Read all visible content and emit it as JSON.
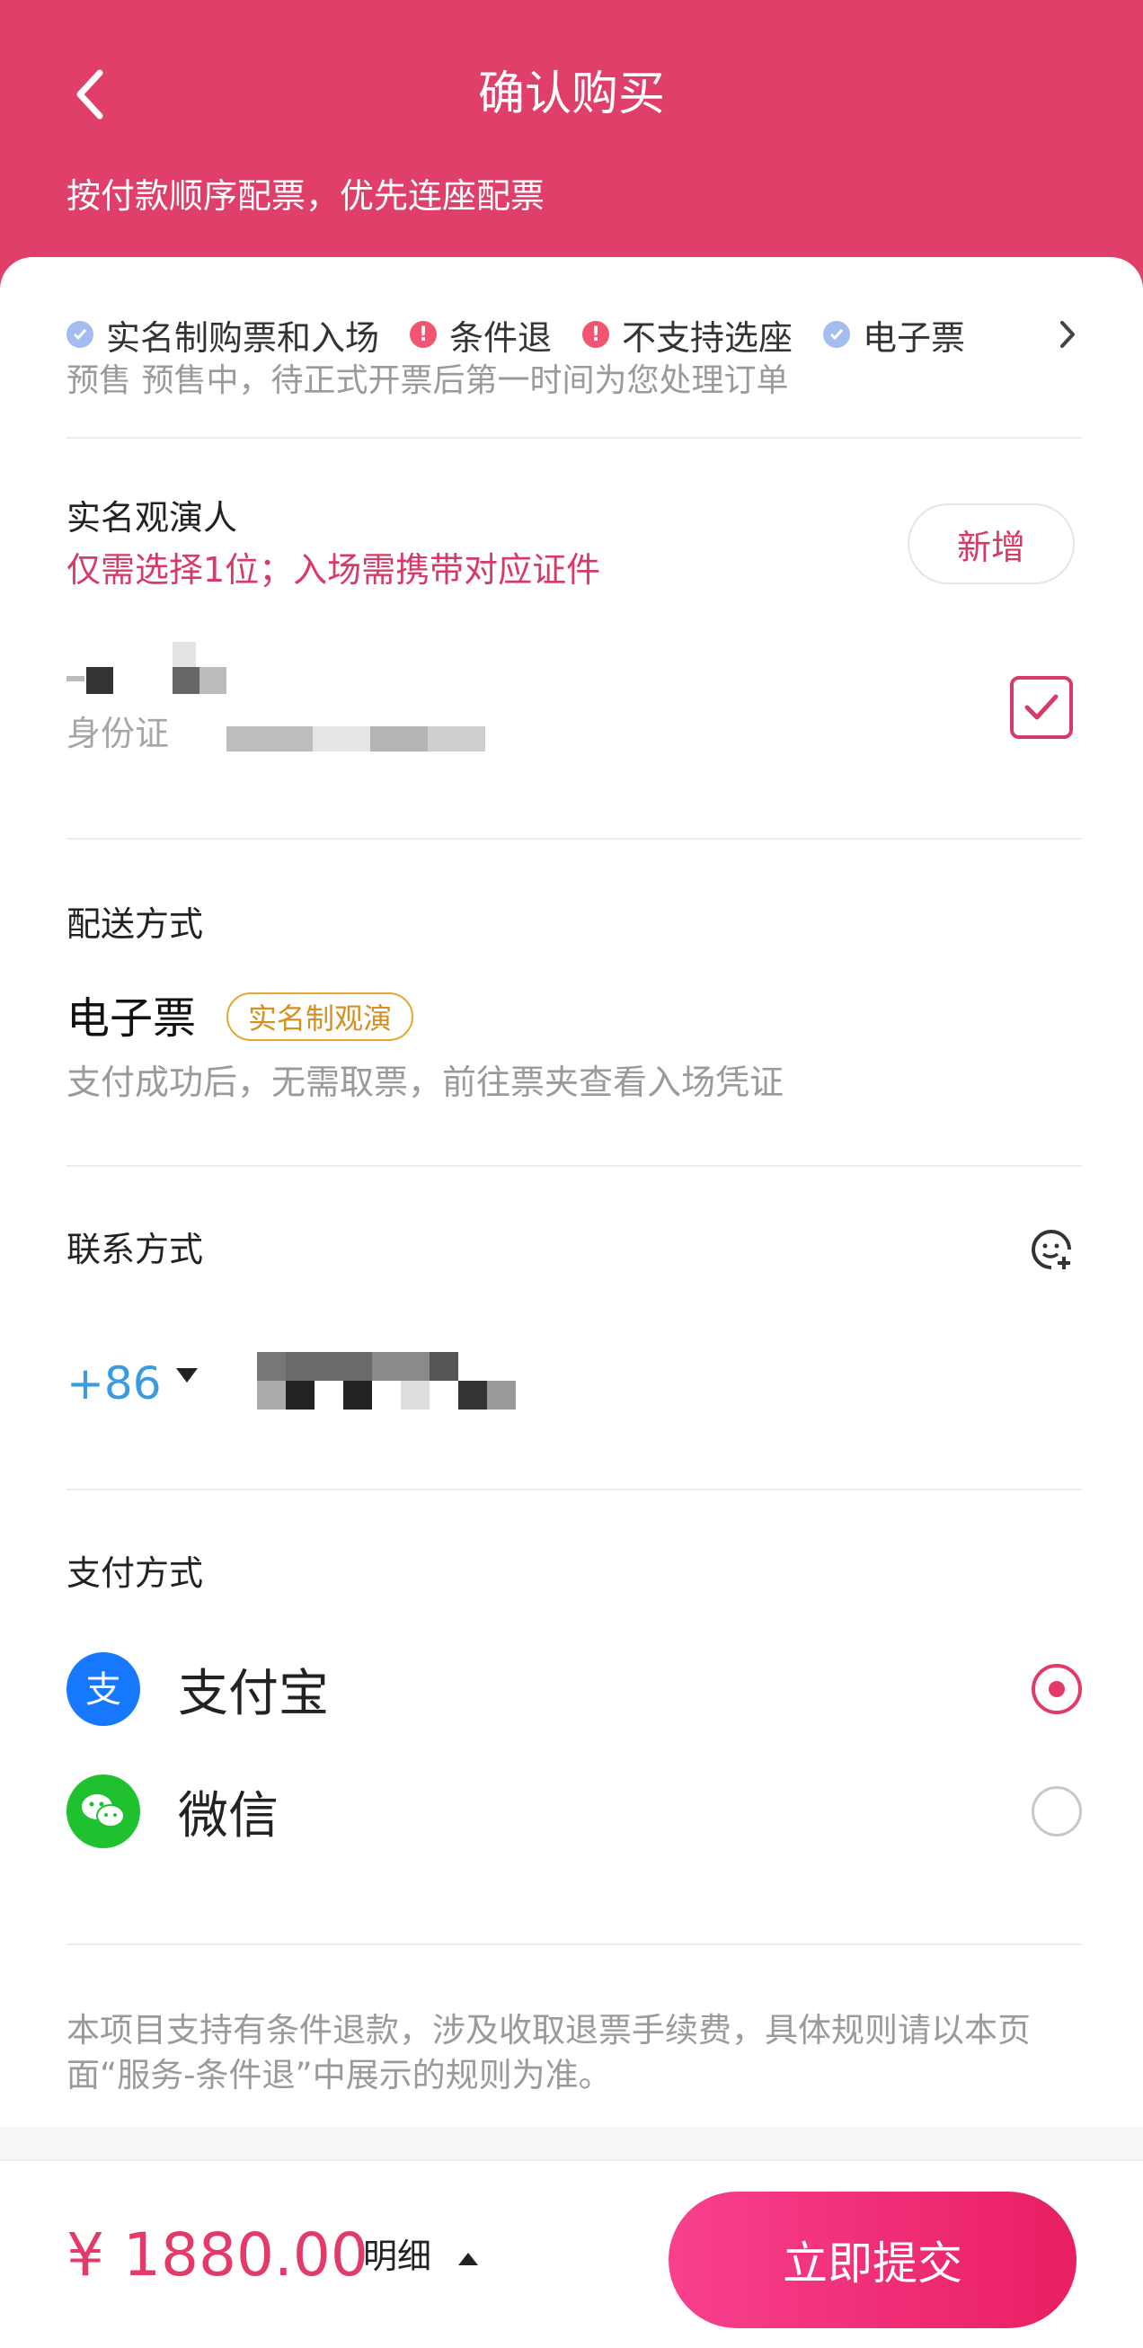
{
  "header": {
    "title": "确认购买",
    "subtitle": "按付款顺序配票，优先连座配票"
  },
  "tags": [
    {
      "label": "实名制购票和入场",
      "kind": "ok"
    },
    {
      "label": "条件退",
      "kind": "warn"
    },
    {
      "label": "不支持选座",
      "kind": "warn"
    },
    {
      "label": "电子票",
      "kind": "ok"
    }
  ],
  "presale_note": "预售 预售中，待正式开票后第一时间为您处理订单",
  "attendee": {
    "title": "实名观演人",
    "note": "仅需选择1位；入场需携带对应证件",
    "add_label": "新增",
    "id_label": "身份证"
  },
  "delivery": {
    "title": "配送方式",
    "method": "电子票",
    "badge": "实名制观演",
    "desc": "支付成功后，无需取票，前往票夹查看入场凭证"
  },
  "contact": {
    "title": "联系方式",
    "country_code": "+86"
  },
  "payment": {
    "title": "支付方式",
    "options": [
      {
        "label": "支付宝",
        "selected": true
      },
      {
        "label": "微信",
        "selected": false
      }
    ]
  },
  "refund_note": "本项目支持有条件退款，涉及收取退票手续费，具体规则请以本页面“服务-条件退”中展示的规则为准。",
  "footer": {
    "price": "¥ 1880.00",
    "detail_label": "明细",
    "submit_label": "立即提交"
  },
  "colors": {
    "brand": "#df3f68",
    "accent": "#e33a6a",
    "link_blue": "#3a9bdf",
    "badge_gold": "#d49121"
  }
}
